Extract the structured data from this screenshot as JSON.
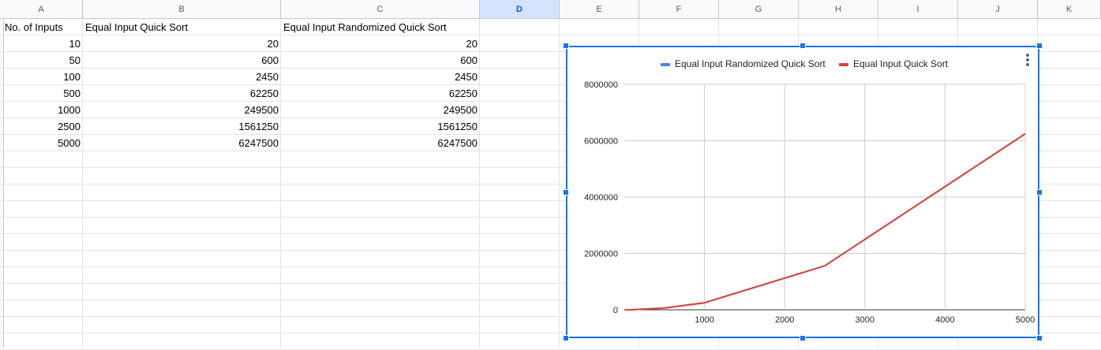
{
  "columns": [
    "A",
    "B",
    "C",
    "D",
    "E",
    "F",
    "G",
    "H",
    "I",
    "J",
    "K"
  ],
  "selected_column": "D",
  "headers": [
    "No. of Inputs",
    "Equal Input Quick Sort",
    "Equal Input Randomized Quick Sort"
  ],
  "rows": [
    [
      "10",
      "20",
      "20"
    ],
    [
      "50",
      "600",
      "600"
    ],
    [
      "100",
      "2450",
      "2450"
    ],
    [
      "500",
      "62250",
      "62250"
    ],
    [
      "1000",
      "249500",
      "249500"
    ],
    [
      "2500",
      "1561250",
      "1561250"
    ],
    [
      "5000",
      "6247500",
      "6247500"
    ]
  ],
  "colors": {
    "randomized": "#4285f4",
    "quick": "#db4437",
    "selection": "#1a73e8"
  },
  "chart_data": {
    "type": "line",
    "title": "",
    "xlabel": "",
    "ylabel": "",
    "legend_position": "top",
    "grid": true,
    "x": [
      10,
      50,
      100,
      500,
      1000,
      2500,
      5000
    ],
    "series": [
      {
        "name": "Equal Input Randomized Quick Sort",
        "values": [
          20,
          600,
          2450,
          62250,
          249500,
          1561250,
          6247500
        ],
        "color": "#4285f4"
      },
      {
        "name": "Equal Input Quick Sort",
        "values": [
          20,
          600,
          2450,
          62250,
          249500,
          1561250,
          6247500
        ],
        "color": "#db4437"
      }
    ],
    "xlim": [
      0,
      5000
    ],
    "ylim": [
      0,
      8000000
    ],
    "x_ticks": [
      "1000",
      "2000",
      "3000",
      "4000",
      "5000"
    ],
    "y_ticks": [
      "0",
      "2000000",
      "4000000",
      "6000000",
      "8000000"
    ]
  },
  "menu_icon": "kebab-menu-icon"
}
